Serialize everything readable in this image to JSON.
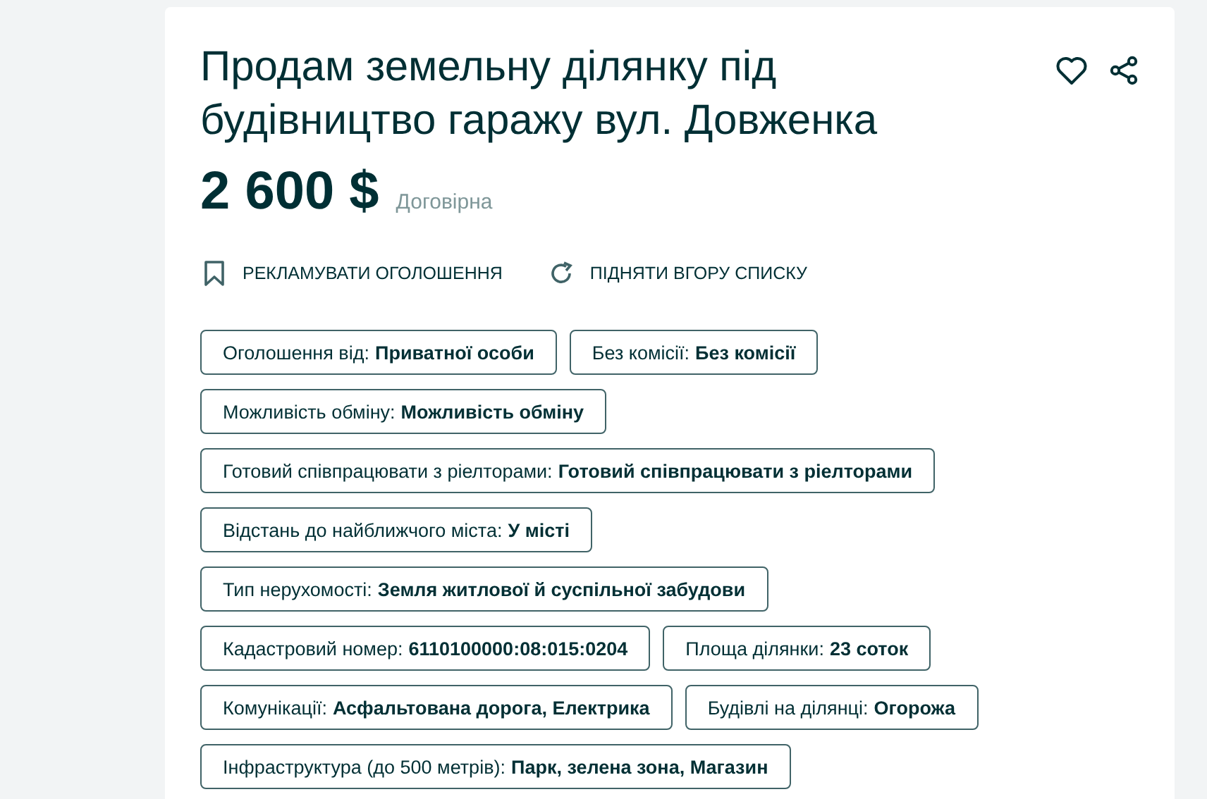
{
  "listing": {
    "title": "Продам земельну ділянку під будівництво гаражу вул. Довженка",
    "price": "2 600 $",
    "price_note": "Договірна",
    "actions": [
      {
        "kind": "promote",
        "label": "РЕКЛАМУВАТИ ОГОЛОШЕННЯ"
      },
      {
        "kind": "refresh",
        "label": "ПІДНЯТИ ВГОРУ СПИСКУ"
      }
    ],
    "tag_rows": [
      [
        {
          "label": "Оголошення від:",
          "value": "Приватної особи"
        },
        {
          "label": "Без комісії:",
          "value": "Без комісії"
        }
      ],
      [
        {
          "label": "Можливість обміну:",
          "value": "Можливість обміну"
        }
      ],
      [
        {
          "label": "Готовий співпрацювати з ріелторами:",
          "value": "Готовий співпрацювати з ріелторами"
        }
      ],
      [
        {
          "label": "Відстань до найближчого міста:",
          "value": "У місті"
        }
      ],
      [
        {
          "label": "Тип нерухомості:",
          "value": "Земля житлової й суспільної забудови"
        }
      ],
      [
        {
          "label": "Кадастровий номер:",
          "value": "6110100000:08:015:0204"
        },
        {
          "label": "Площа ділянки:",
          "value": "23 соток"
        }
      ],
      [
        {
          "label": "Комунікації:",
          "value": "Асфальтована дорога, Електрика"
        },
        {
          "label": "Будівлі на ділянці:",
          "value": "Огорожа"
        }
      ],
      [
        {
          "label": "Інфраструктура (до 500 метрів):",
          "value": "Парк, зелена зона, Магазин"
        }
      ]
    ]
  }
}
